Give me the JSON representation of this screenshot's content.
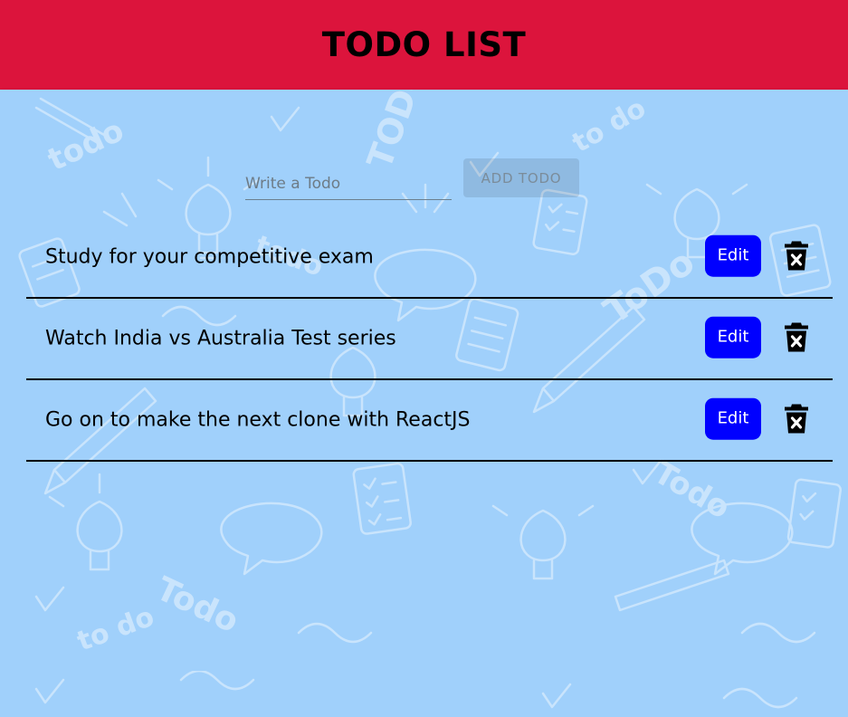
{
  "header": {
    "title": "TODO LIST"
  },
  "form": {
    "input_value": "",
    "input_placeholder": "Write a Todo",
    "add_button_label": "ADD TODO"
  },
  "todos": [
    {
      "text": "Study for your competitive exam",
      "edit_label": "Edit",
      "delete_icon": "trash-x-icon"
    },
    {
      "text": "Watch India vs Australia Test series",
      "edit_label": "Edit",
      "delete_icon": "trash-x-icon"
    },
    {
      "text": "Go on to make the next clone with ReactJS",
      "edit_label": "Edit",
      "delete_icon": "trash-x-icon"
    }
  ],
  "colors": {
    "header_bg": "#dc143c",
    "page_bg": "#a0d0fb",
    "edit_button_bg": "#0000ff",
    "divider": "#000000"
  }
}
